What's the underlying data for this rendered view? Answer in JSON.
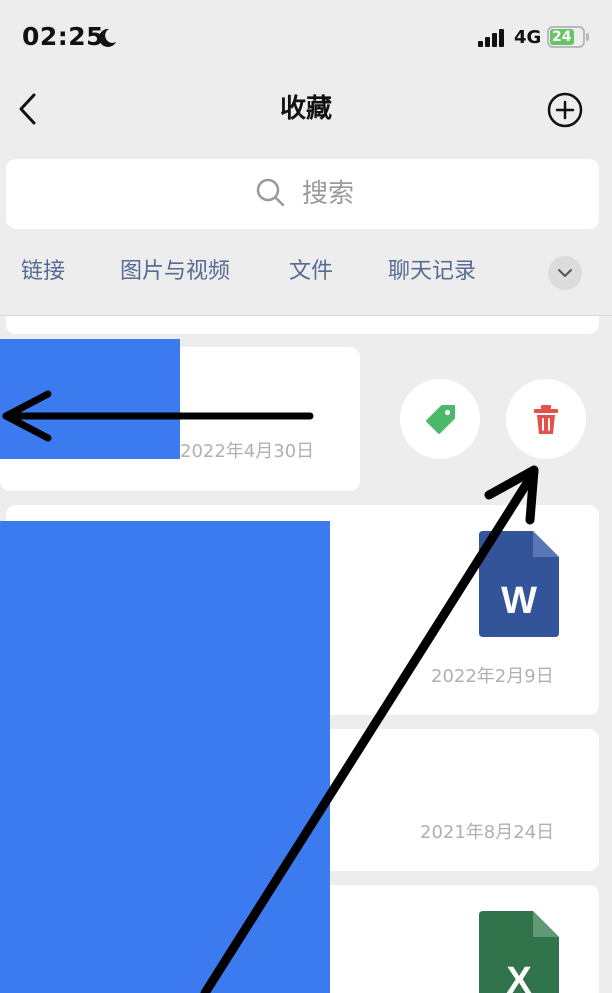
{
  "status_bar": {
    "time": "02:25",
    "network": "4G",
    "battery": "24",
    "battery_level": 0.24,
    "icons": [
      "moon-icon",
      "signal-icon",
      "battery-icon"
    ]
  },
  "nav": {
    "title": "收藏",
    "back_icon": "chevron-left-icon",
    "add_icon": "plus-circle-icon"
  },
  "search": {
    "placeholder": "搜索",
    "icon": "search-icon"
  },
  "tabs": [
    {
      "label": "链接"
    },
    {
      "label": "图片与视频"
    },
    {
      "label": "文件"
    },
    {
      "label": "聊天记录"
    }
  ],
  "tabs_expand_icon": "chevron-down-icon",
  "items": [
    {
      "date": "2022年4月30日",
      "actions": [
        {
          "name": "tag",
          "icon": "tag-icon",
          "color": "#4cb96a"
        },
        {
          "name": "delete",
          "icon": "trash-icon",
          "color": "#e5504b"
        }
      ]
    },
    {
      "date": "2022年2月9日",
      "file_type": "W",
      "file_color": "#34549a"
    },
    {
      "date": "2021年8月24日"
    },
    {
      "file_type": "X",
      "file_color": "#31734a"
    }
  ],
  "colors": {
    "background": "#ededed",
    "tab_text": "#576b95",
    "redaction": "#3b7bef"
  }
}
